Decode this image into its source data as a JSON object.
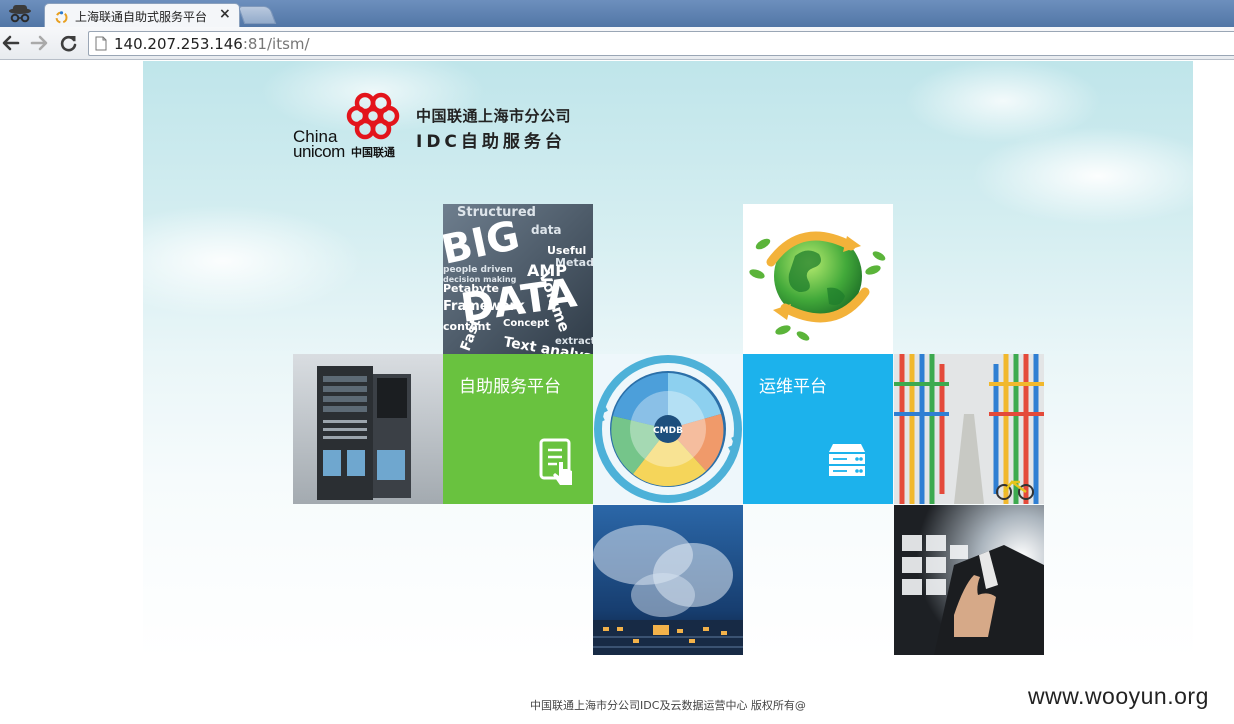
{
  "browser": {
    "tab_title": "上海联通自助式服务平台",
    "tab_close": "×",
    "url_host": "140.207.253.146",
    "url_rest": ":81/itsm/"
  },
  "logo": {
    "en_line1": "China",
    "en_line2": "unicom",
    "cn_small": "中国联通",
    "title_line1": "中国联通上海市分公司",
    "title_line2": "IDC自助服务台"
  },
  "tiles": {
    "self_service_label": "自助服务平台",
    "ops_label": "运维平台",
    "bigdata_words": [
      "BIG",
      "DATA",
      "Structured",
      "data",
      "Volume",
      "Useful",
      "Metadata",
      "AMP",
      "people driven",
      "decision making",
      "Petabyte",
      "Framework",
      "Concept",
      "Text analysis",
      "content",
      "extraction",
      "Fast"
    ],
    "cmdb_label": "CMDB"
  },
  "footer": {
    "copyright": "中国联通上海市分公司IDC及云数据运营中心 版权所有@"
  },
  "watermark": "www.wooyun.org",
  "colors": {
    "tile_green": "#69c23f",
    "tile_blue": "#1cb2ec",
    "unicom_red": "#e3141b"
  }
}
